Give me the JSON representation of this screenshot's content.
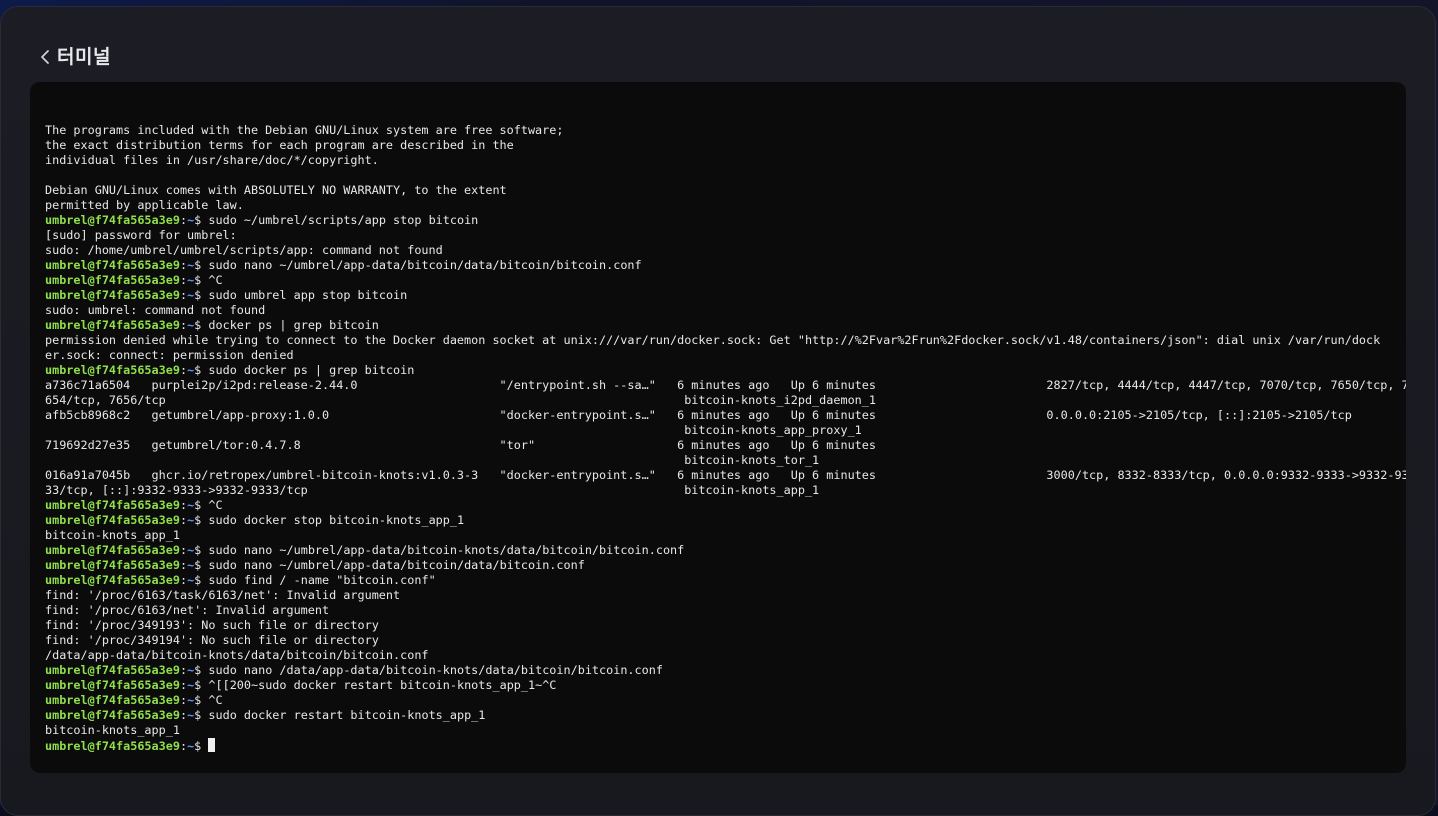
{
  "header": {
    "title": "터미널"
  },
  "terminal": {
    "prompt_user": "umbrel@f74fa565a3e9",
    "prompt_path": "~",
    "lines": [
      {
        "type": "out",
        "text": ""
      },
      {
        "type": "out",
        "text": "The programs included with the Debian GNU/Linux system are free software;"
      },
      {
        "type": "out",
        "text": "the exact distribution terms for each program are described in the"
      },
      {
        "type": "out",
        "text": "individual files in /usr/share/doc/*/copyright."
      },
      {
        "type": "out",
        "text": ""
      },
      {
        "type": "out",
        "text": "Debian GNU/Linux comes with ABSOLUTELY NO WARRANTY, to the extent"
      },
      {
        "type": "out",
        "text": "permitted by applicable law."
      },
      {
        "type": "cmd",
        "text": "sudo ~/umbrel/scripts/app stop bitcoin"
      },
      {
        "type": "out",
        "text": "[sudo] password for umbrel:"
      },
      {
        "type": "out",
        "text": "sudo: /home/umbrel/umbrel/scripts/app: command not found"
      },
      {
        "type": "cmd",
        "text": "sudo nano ~/umbrel/app-data/bitcoin/data/bitcoin/bitcoin.conf"
      },
      {
        "type": "cmd",
        "text": "^C"
      },
      {
        "type": "cmd",
        "text": "sudo umbrel app stop bitcoin"
      },
      {
        "type": "out",
        "text": "sudo: umbrel: command not found"
      },
      {
        "type": "cmd",
        "text": "docker ps | grep bitcoin"
      },
      {
        "type": "out",
        "text": "permission denied while trying to connect to the Docker daemon socket at unix:///var/run/docker.sock: Get \"http://%2Fvar%2Frun%2Fdocker.sock/v1.48/containers/json\": dial unix /var/run/dock"
      },
      {
        "type": "out",
        "text": "er.sock: connect: permission denied"
      },
      {
        "type": "cmd",
        "text": "sudo docker ps | grep bitcoin"
      },
      {
        "type": "out",
        "text": "a736c71a6504   purplei2p/i2pd:release-2.44.0                    \"/entrypoint.sh --sa…\"   6 minutes ago   Up 6 minutes                        2827/tcp, 4444/tcp, 4447/tcp, 7070/tcp, 7650/tcp, 7"
      },
      {
        "type": "out",
        "text": "654/tcp, 7656/tcp                                                                         bitcoin-knots_i2pd_daemon_1"
      },
      {
        "type": "out",
        "text": "afb5cb8968c2   getumbrel/app-proxy:1.0.0                        \"docker-entrypoint.s…\"   6 minutes ago   Up 6 minutes                        0.0.0.0:2105->2105/tcp, [::]:2105->2105/tcp"
      },
      {
        "type": "out",
        "text": "                                                                                          bitcoin-knots_app_proxy_1"
      },
      {
        "type": "out",
        "text": "719692d27e35   getumbrel/tor:0.4.7.8                            \"tor\"                    6 minutes ago   Up 6 minutes"
      },
      {
        "type": "out",
        "text": "                                                                                          bitcoin-knots_tor_1"
      },
      {
        "type": "out",
        "text": "016a91a7045b   ghcr.io/retropex/umbrel-bitcoin-knots:v1.0.3-3   \"docker-entrypoint.s…\"   6 minutes ago   Up 6 minutes                        3000/tcp, 8332-8333/tcp, 0.0.0.0:9332-9333->9332-93"
      },
      {
        "type": "out",
        "text": "33/tcp, [::]:9332-9333->9332-9333/tcp                                                     bitcoin-knots_app_1"
      },
      {
        "type": "cmd",
        "text": "^C"
      },
      {
        "type": "cmd",
        "text": "sudo docker stop bitcoin-knots_app_1"
      },
      {
        "type": "out",
        "text": "bitcoin-knots_app_1"
      },
      {
        "type": "cmd",
        "text": "sudo nano ~/umbrel/app-data/bitcoin-knots/data/bitcoin/bitcoin.conf"
      },
      {
        "type": "cmd",
        "text": "sudo nano ~/umbrel/app-data/bitcoin/data/bitcoin.conf"
      },
      {
        "type": "cmd",
        "text": "sudo find / -name \"bitcoin.conf\""
      },
      {
        "type": "out",
        "text": "find: '/proc/6163/task/6163/net': Invalid argument"
      },
      {
        "type": "out",
        "text": "find: '/proc/6163/net': Invalid argument"
      },
      {
        "type": "out",
        "text": "find: '/proc/349193': No such file or directory"
      },
      {
        "type": "out",
        "text": "find: '/proc/349194': No such file or directory"
      },
      {
        "type": "out",
        "text": "/data/app-data/bitcoin-knots/data/bitcoin/bitcoin.conf"
      },
      {
        "type": "cmd",
        "text": "sudo nano /data/app-data/bitcoin-knots/data/bitcoin/bitcoin.conf"
      },
      {
        "type": "cmd",
        "text": "^[[200~sudo docker restart bitcoin-knots_app_1~^C"
      },
      {
        "type": "cmd",
        "text": "^C"
      },
      {
        "type": "cmd",
        "text": "sudo docker restart bitcoin-knots_app_1"
      },
      {
        "type": "out",
        "text": "bitcoin-knots_app_1"
      },
      {
        "type": "cmd",
        "text": ""
      }
    ]
  },
  "colors": {
    "prompt_user": "#8fe04a",
    "prompt_path": "#5b9bff",
    "terminal_bg": "#0b0b0c",
    "panel_bg": "#1c1d24"
  },
  "icons": {
    "back": "chevron-left-icon",
    "cursor": "block-cursor"
  }
}
